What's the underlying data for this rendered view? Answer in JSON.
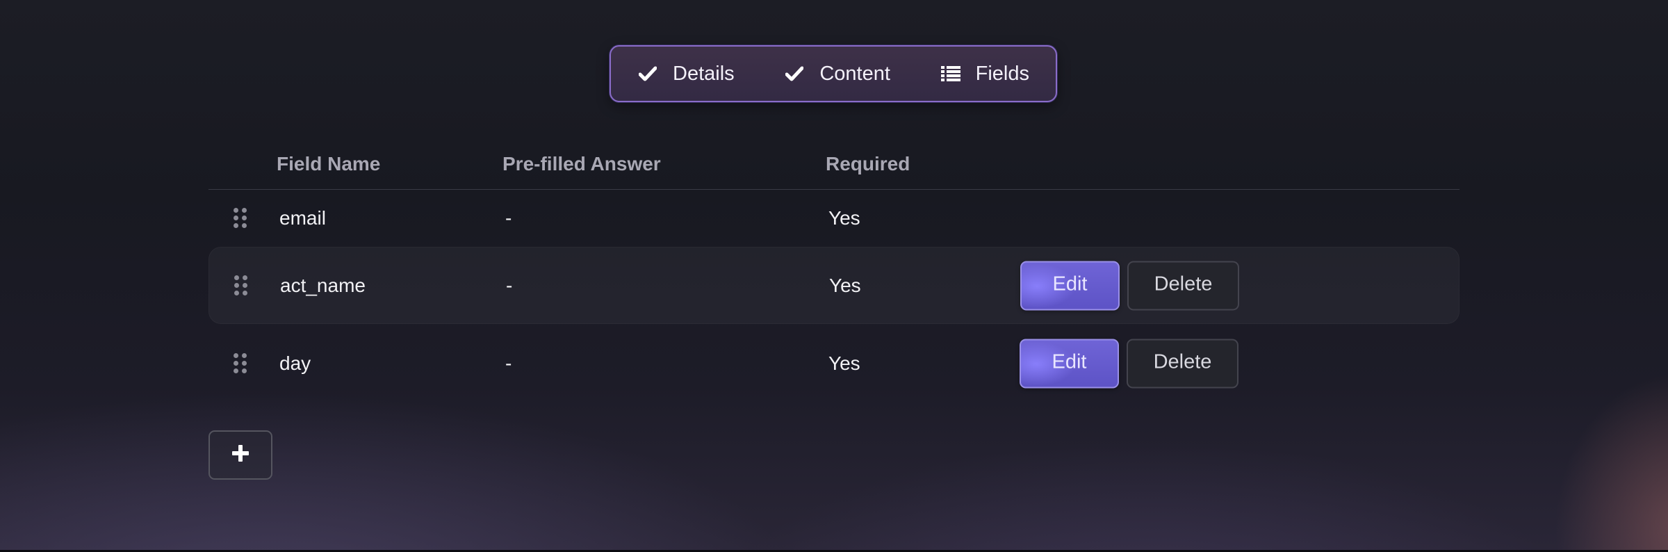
{
  "stepper": {
    "steps": [
      {
        "label": "Details",
        "icon": "check-icon",
        "state": "complete"
      },
      {
        "label": "Content",
        "icon": "check-icon",
        "state": "complete"
      },
      {
        "label": "Fields",
        "icon": "list-icon",
        "state": "current"
      }
    ]
  },
  "table": {
    "headers": {
      "field_name": "Field Name",
      "prefilled": "Pre-filled Answer",
      "required": "Required"
    },
    "rows": [
      {
        "field_name": "email",
        "prefilled": "-",
        "required": "Yes",
        "actions": false
      },
      {
        "field_name": "act_name",
        "prefilled": "-",
        "required": "Yes",
        "actions": true
      },
      {
        "field_name": "day",
        "prefilled": "-",
        "required": "Yes",
        "actions": true
      }
    ],
    "edit_label": "Edit",
    "delete_label": "Delete"
  },
  "add_button": {
    "icon": "plus-icon"
  },
  "colors": {
    "accent": "#6f64d6",
    "stepper_border": "#8a6cc9",
    "background": "#1c1d25"
  }
}
